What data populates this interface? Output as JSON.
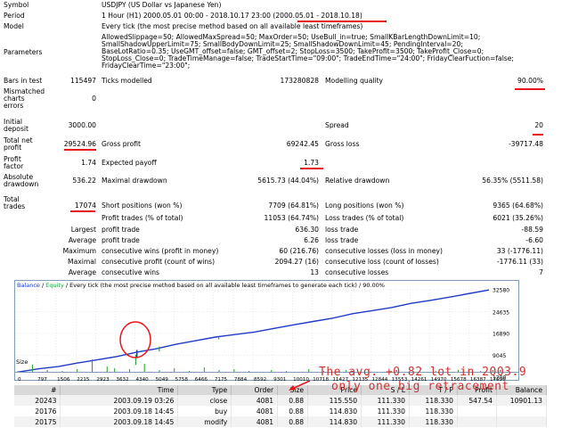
{
  "header": {
    "symbol_label": "Symbol",
    "symbol_value": "USDJPY (US Dollar vs Japanese Yen)",
    "period_label": "Period",
    "period_prefix": "1 Hour (H1) 2000.05.01 00:00 - 2018.10.17 23:00 ",
    "period_highlight": "(2000.05.01 - 2018.10.18)",
    "model_label": "Model",
    "model_value": "Every tick (the most precise method based on all available least timeframes)",
    "parameters_label": "Parameters",
    "parameters_lines": [
      "AllowedSlippage=50; AllowedMaxSpread=50; MaxOrder=50; UseBull_in=true; SmallKBarLengthDownLimit=10;",
      "SmallShadowUpperLimit=75; SmallBodyDownLimit=25; SmallShadowDownLimit=45; PendingInterval=20;",
      "BaseLotRatio=0.35; UseGMT_offset=false; GMT_offset=2; StopLoss=3500; TakeProfit=3500; TakeProfit_Close=0;",
      "StopLoss_Close=0; TradeTimeManage=false; TradeStartTime=\"09:00\"; TradeEndTime=\"24:00\"; FridayClearFuction=false;",
      "FridayClearTime=\"23:00\";"
    ]
  },
  "stats": {
    "bars_label": "Bars in test",
    "bars_value": "115497",
    "ticks_label": "Ticks modelled",
    "ticks_value": "173280828",
    "quality_label": "Modelling quality",
    "quality_value": "90.00%",
    "mismatched_label_1": "Mismatched",
    "mismatched_label_2": "charts",
    "mismatched_label_3": "errors",
    "mismatched_value": "0",
    "initial_label_1": "Initial",
    "initial_label_2": "deposit",
    "initial_value": "3000.00",
    "spread_label": "Spread",
    "spread_value": "20",
    "netprofit_label_1": "Total net",
    "netprofit_label_2": "profit",
    "netprofit_value": "29524.96",
    "grossprofit_label": "Gross profit",
    "grossprofit_value": "69242.45",
    "grossloss_label": "Gross loss",
    "grossloss_value": "-39717.48",
    "pf_label_1": "Profit",
    "pf_label_2": "factor",
    "pf_value": "1.74",
    "payoff_label": "Expected payoff",
    "payoff_value": "1.73",
    "absdd_label_1": "Absolute",
    "absdd_label_2": "drawdown",
    "absdd_value": "536.22",
    "maxdd_label": "Maximal drawdown",
    "maxdd_value": "5615.73 (44.04%)",
    "reldd_label": "Relative drawdown",
    "reldd_value": "56.35% (5511.58)",
    "trades_label_1": "Total",
    "trades_label_2": "trades",
    "trades_value": "17074",
    "short_label": "Short positions (won %)",
    "short_value": "7709 (64.81%)",
    "long_label": "Long positions (won %)",
    "long_value": "9365 (64.68%)",
    "profit_trades_label": "Profit trades (% of total)",
    "profit_trades_value": "11053 (64.74%)",
    "loss_trades_label": "Loss trades (% of total)",
    "loss_trades_value": "6021 (35.26%)",
    "largest_label": "Largest",
    "largest_profit_label": "profit trade",
    "largest_profit_value": "636.30",
    "largest_loss_label": "loss trade",
    "largest_loss_value": "-88.59",
    "average_label": "Average",
    "average_profit_label": "profit trade",
    "average_profit_value": "6.26",
    "average_loss_label": "loss trade",
    "average_loss_value": "-6.60",
    "maximum_label": "Maximum",
    "max_cwins_label": "consecutive wins (profit in money)",
    "max_cwins_value": "60 (216.76)",
    "max_closs_label": "consecutive losses (loss in money)",
    "max_closs_value": "33 (-1776.11)",
    "maximal_label": "Maximal",
    "maximal_cprofit_label": "consecutive profit (count of wins)",
    "maximal_cprofit_value": "2094.27 (16)",
    "maximal_closs_label": "consecutive loss (count of losses)",
    "maximal_closs_value": "-1776.11 (33)",
    "avg2_label": "Average",
    "avg_cwins_label": "consecutive wins",
    "avg_cwins_value": "13",
    "avg_closs_label": "consecutive losses",
    "avg_closs_value": "7"
  },
  "chart": {
    "legend_balance": "Balance",
    "legend_sep": " / ",
    "legend_equity": "Equity",
    "legend_rest": " / Every tick (the most precise method based on all available least timeframes to generate each tick) / 90.00%",
    "size_label": "Size",
    "colors": {
      "balance": "#1f3bc7",
      "equity": "#2aa64a",
      "size_bars": "#1aa31a",
      "grid": "#d6d6d6",
      "highlight": "#e8151b"
    }
  },
  "chart_data": {
    "type": "line",
    "title": "",
    "y_ticks": [
      "32580",
      "24635",
      "16890",
      "9045",
      "1200"
    ],
    "x_ticks": [
      "0",
      "797",
      "1506",
      "2215",
      "2923",
      "3632",
      "4340",
      "5049",
      "5758",
      "6466",
      "7175",
      "7884",
      "8592",
      "9301",
      "10010",
      "10718",
      "11427",
      "12135",
      "12844",
      "13553",
      "14261",
      "14970",
      "15678",
      "16387",
      "17096"
    ],
    "ylim": [
      1200,
      32580
    ],
    "xlim": [
      0,
      17074
    ],
    "series": [
      {
        "x": [
          0,
          800,
          1500,
          2200,
          2900,
          3600,
          4340,
          5050,
          5760,
          6470,
          7180,
          7880,
          8590,
          9300,
          10010,
          10720,
          11430,
          12140,
          12840,
          13550,
          14260,
          14970,
          15680,
          16390,
          17074
        ],
        "values": [
          3000,
          4200,
          5000,
          6300,
          7400,
          8600,
          10200,
          11400,
          13000,
          14300,
          15600,
          16500,
          17400,
          18700,
          20000,
          21200,
          22400,
          24000,
          25100,
          26200,
          27700,
          28800,
          30000,
          31300,
          32525
        ]
      }
    ]
  },
  "overlay": {
    "line1": "The avg. +0.82 lot in 2003.9",
    "line2": "only one big retracement"
  },
  "table": {
    "headers": [
      "#",
      "Time",
      "Type",
      "Order",
      "Size",
      "Price",
      "S / L",
      "T / P",
      "Profit",
      "Balance"
    ],
    "rows": [
      [
        "20243",
        "2003.09.19 03:26",
        "close",
        "4081",
        "0.88",
        "115.550",
        "111.330",
        "118.330",
        "547.54",
        "10901.13"
      ],
      [
        "20176",
        "2003.09.18 14:45",
        "buy",
        "4081",
        "0.88",
        "114.830",
        "111.330",
        "118.330",
        "",
        ""
      ],
      [
        "20175",
        "2003.09.18 14:45",
        "modify",
        "4081",
        "0.88",
        "114.830",
        "111.330",
        "118.330",
        "",
        ""
      ]
    ]
  }
}
